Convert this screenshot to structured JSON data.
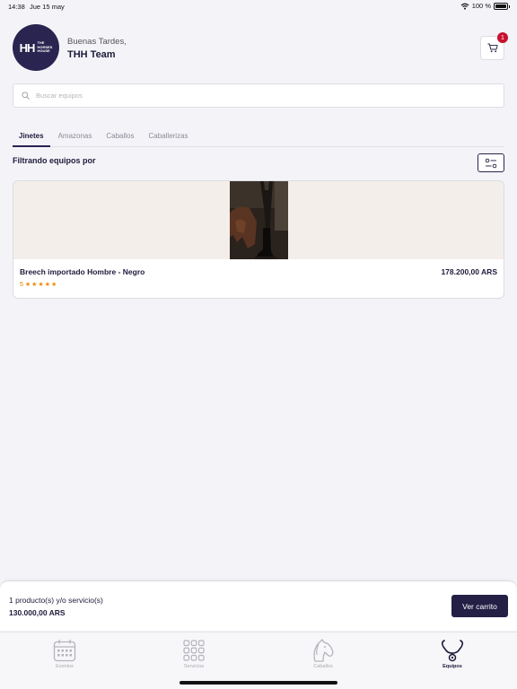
{
  "status_bar": {
    "time": "14:38",
    "date": "Jue 15 may",
    "battery": "100 %"
  },
  "header": {
    "logo_mark": "HH",
    "logo_text_line1": "THE",
    "logo_text_line2": "HORSES",
    "logo_text_line3": "HOUSE",
    "greeting": "Buenas Tardes,",
    "user_name": "THH Team",
    "cart_count": "1"
  },
  "search": {
    "placeholder": "Buscar equipos",
    "value": ""
  },
  "tabs": [
    {
      "label": "Jinetes",
      "active": true
    },
    {
      "label": "Amazonas",
      "active": false
    },
    {
      "label": "Caballos",
      "active": false
    },
    {
      "label": "Caballerizas",
      "active": false
    }
  ],
  "filter": {
    "title": "Filtrando equipos por"
  },
  "products": [
    {
      "name": "Breech importado Hombre - Negro",
      "price": "178.200,00 ARS",
      "rating": "5",
      "stars": "★★★★★"
    }
  ],
  "cart_bar": {
    "summary": "1 producto(s) y/o servicio(s)",
    "total": "130.000,00 ARS",
    "button_label": "Ver carrito"
  },
  "bottom_nav": [
    {
      "label": "Eventos",
      "icon": "calendar-icon",
      "active": false
    },
    {
      "label": "Servicios",
      "icon": "grid-icon",
      "active": false
    },
    {
      "label": "Caballos",
      "icon": "horse-head-icon",
      "active": false
    },
    {
      "label": "Equipos",
      "icon": "stethoscope-icon",
      "active": true
    }
  ],
  "colors": {
    "primary": "#231f45",
    "badge": "#c8102e",
    "star": "#f08a00",
    "background": "#f4f4f8"
  }
}
